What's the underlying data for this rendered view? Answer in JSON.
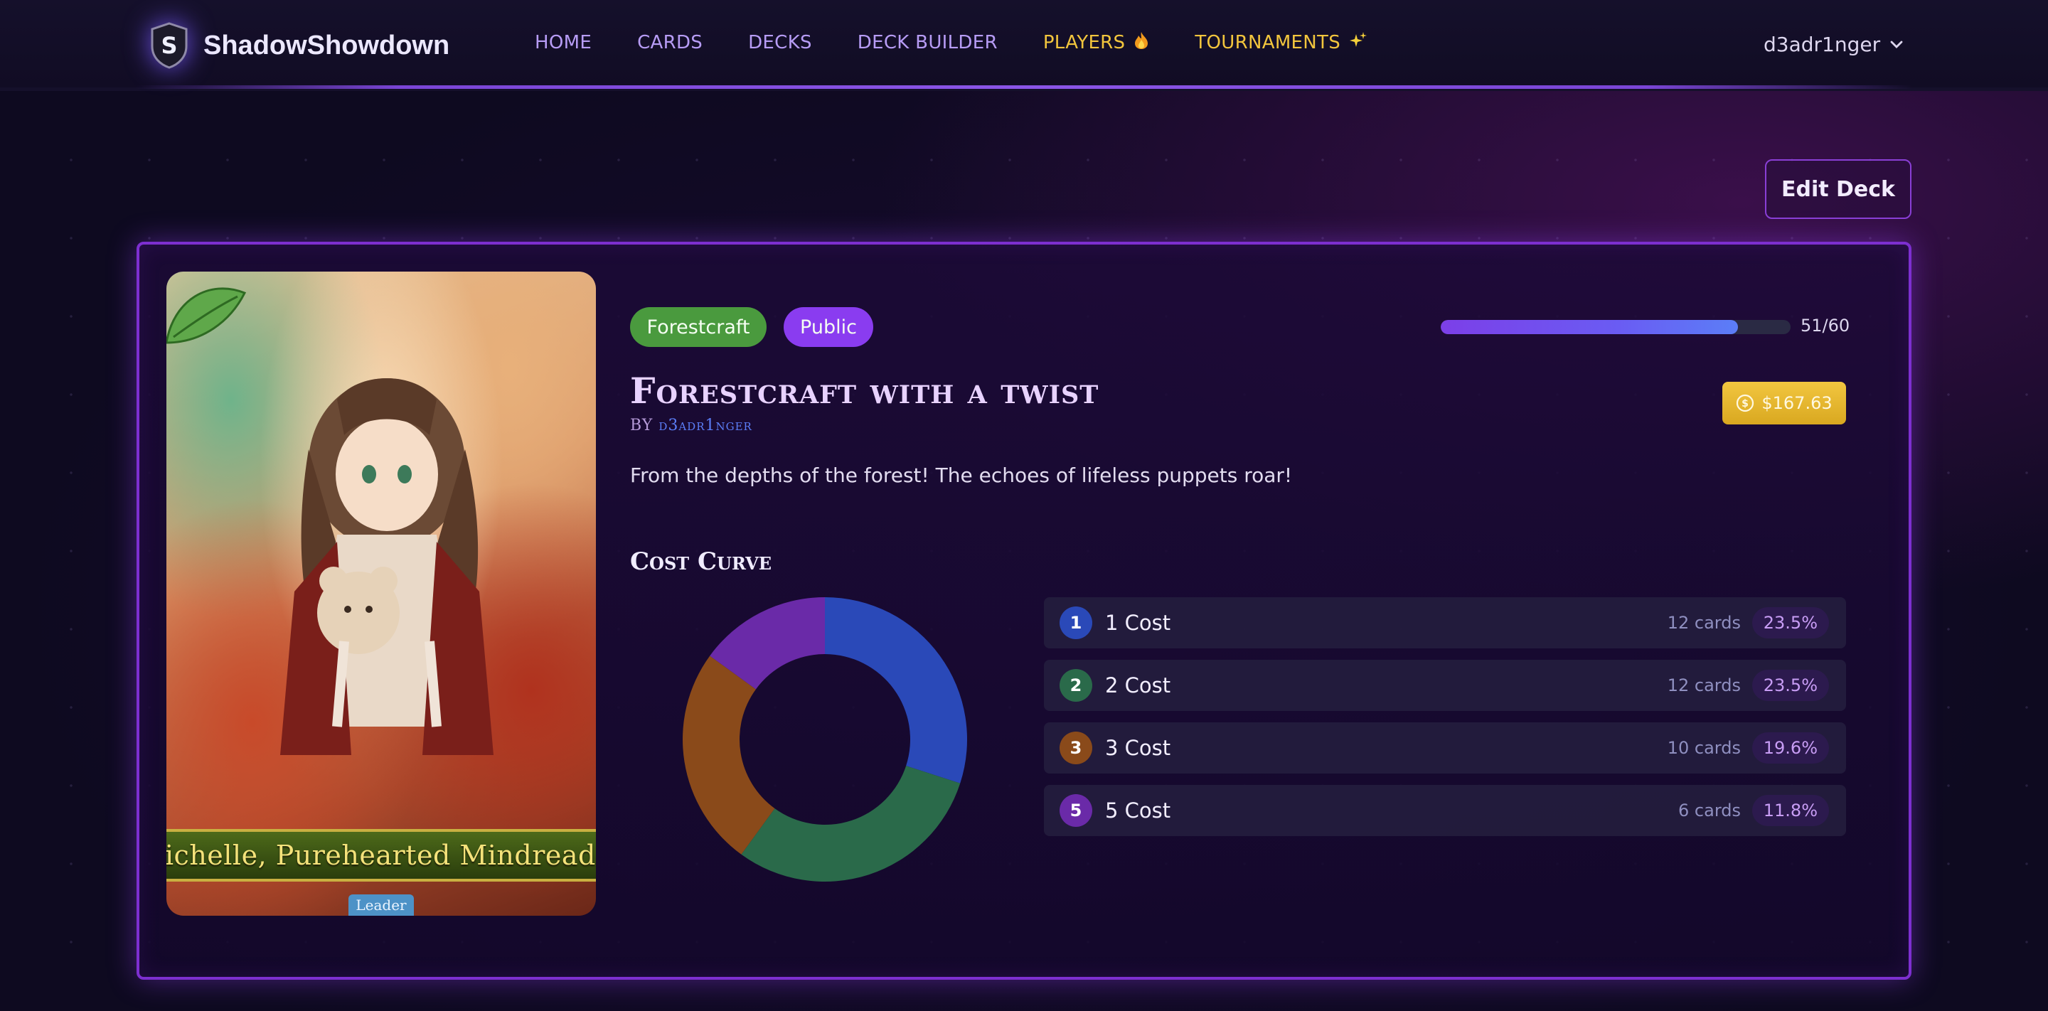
{
  "nav": {
    "brand": "ShadowShowdown",
    "brand_initial": "S",
    "links": [
      {
        "label": "HOME",
        "icon": ""
      },
      {
        "label": "CARDS",
        "icon": ""
      },
      {
        "label": "DECKS",
        "icon": ""
      },
      {
        "label": "DECK BUILDER",
        "icon": ""
      },
      {
        "label": "PLAYERS",
        "icon": "fire-icon"
      },
      {
        "label": "TOURNAMENTS",
        "icon": "sparkles-icon"
      }
    ],
    "user": "d3adr1nger"
  },
  "edit_button": "Edit Deck",
  "deck": {
    "leader_name": "Michelle, Purehearted Mindreader",
    "leader_tag": "Leader",
    "craft": "Forestcraft",
    "visibility": "Public",
    "progress_text": "51/60",
    "progress_fraction": 0.85,
    "title": "Forestcraft with a twist",
    "by_prefix": "BY",
    "author": "d3adr1nger",
    "price": "$167.63",
    "description": "From the depths of the forest! The echoes of lifeless puppets roar!"
  },
  "cost_curve": {
    "heading": "Cost Curve",
    "rows": [
      {
        "num": "1",
        "label": "1 Cost",
        "count": "12 cards",
        "pct": "23.5%",
        "color": "#2a49b8",
        "value": 12
      },
      {
        "num": "2",
        "label": "2 Cost",
        "count": "12 cards",
        "pct": "23.5%",
        "color": "#2a6a4a",
        "value": 12
      },
      {
        "num": "3",
        "label": "3 Cost",
        "count": "10 cards",
        "pct": "19.6%",
        "color": "#8a4a1a",
        "value": 10
      },
      {
        "num": "5",
        "label": "5 Cost",
        "count": "6 cards",
        "pct": "11.8%",
        "color": "#6a2aa8",
        "value": 6
      }
    ]
  },
  "colors": {
    "accent": "#8a3cf0",
    "gold": "#f2c53d",
    "craft_green": "#4a9a3e",
    "panel_border": "#7d2fd0"
  }
}
